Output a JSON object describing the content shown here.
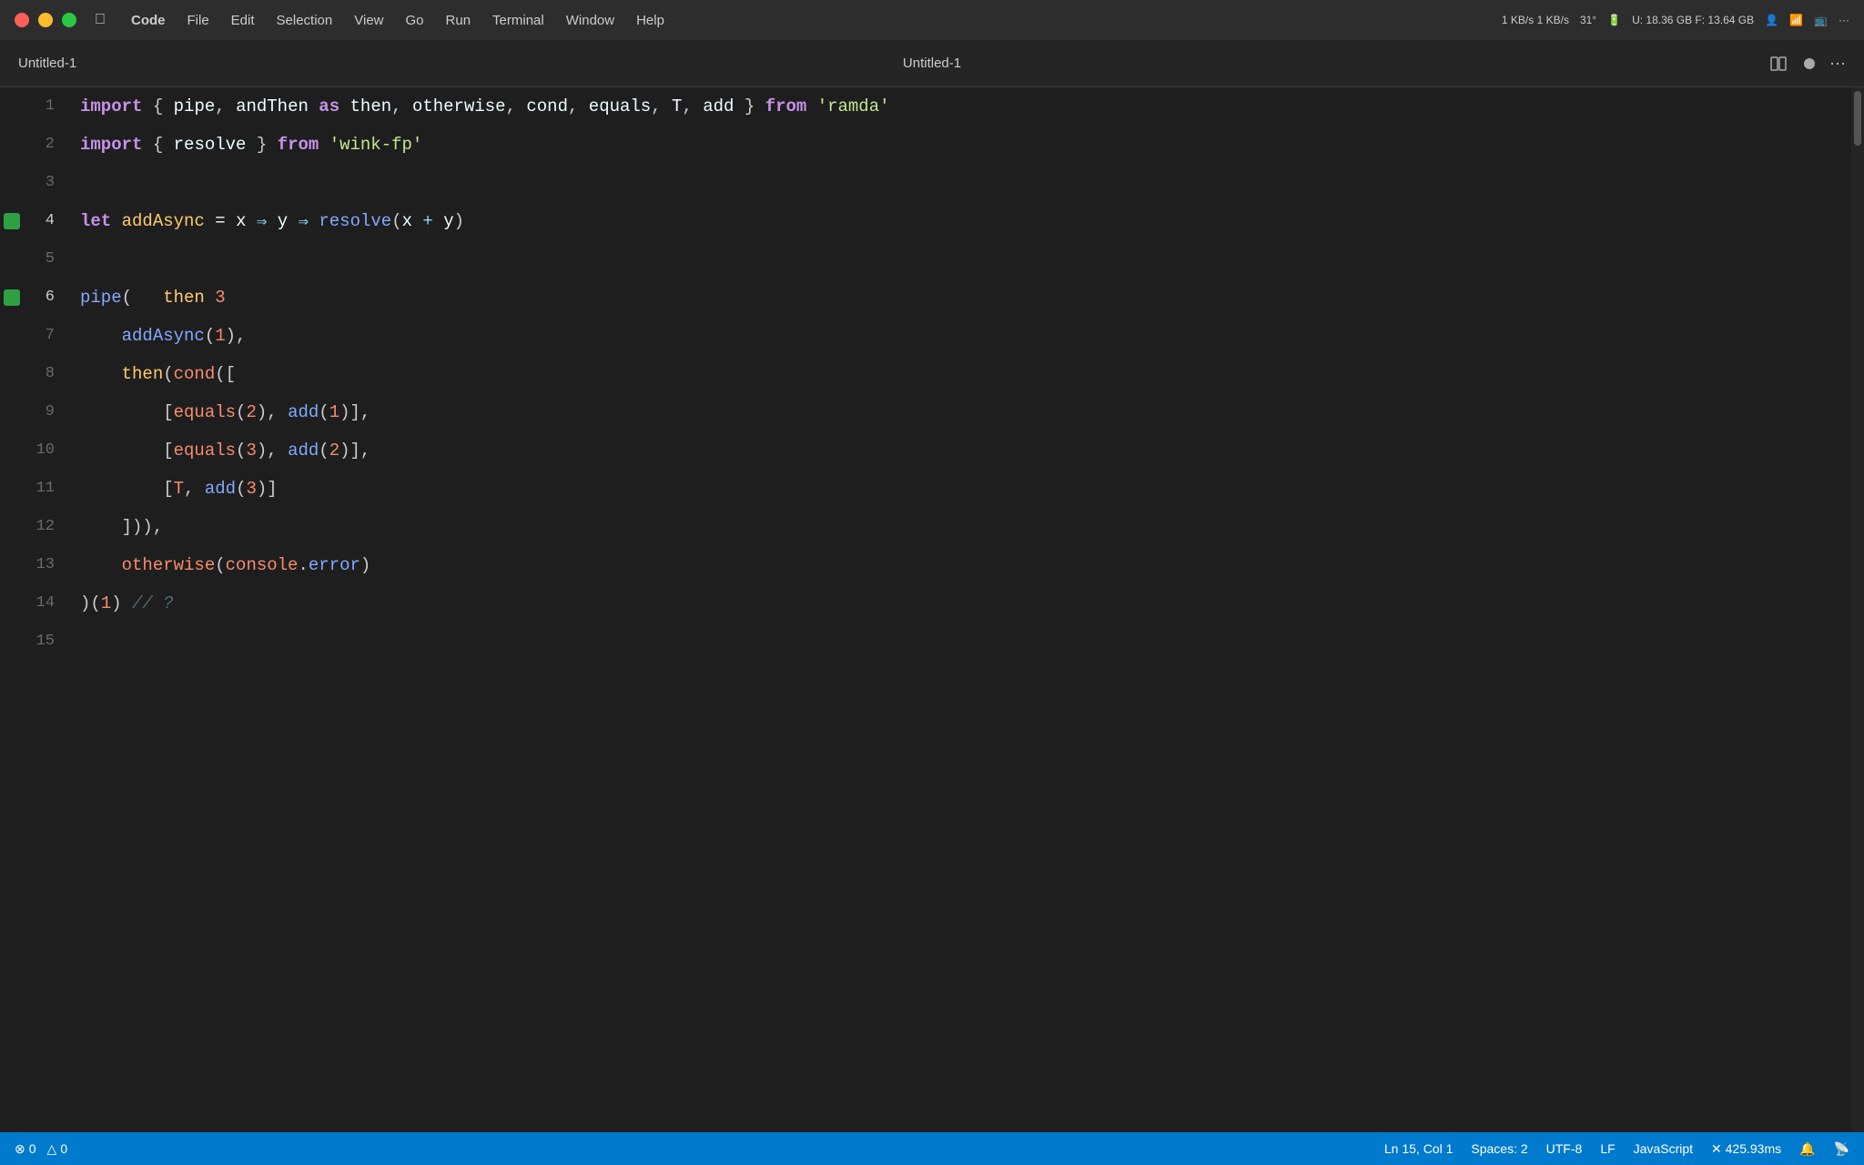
{
  "menubar": {
    "apple": "🍎",
    "items": [
      {
        "label": "Code",
        "bold": true
      },
      {
        "label": "File"
      },
      {
        "label": "Edit"
      },
      {
        "label": "Selection"
      },
      {
        "label": "View"
      },
      {
        "label": "Go"
      },
      {
        "label": "Run"
      },
      {
        "label": "Terminal"
      },
      {
        "label": "Window"
      },
      {
        "label": "Help"
      }
    ],
    "right": {
      "network": "1 KB/s\n1 KB/s",
      "temp": "31°",
      "battery": "🔋",
      "storage": "U: 18.36 GB\nF: 13.64 GB",
      "profile": "👤",
      "wifi": "📶",
      "airplay": "📺",
      "more": "···"
    }
  },
  "titlebar": {
    "title": "Untitled-1",
    "left_label": "Untitled-1"
  },
  "editor": {
    "lines": [
      {
        "num": 1,
        "breakpoint": false,
        "tokens": [
          {
            "text": "import",
            "cls": "kw-import"
          },
          {
            "text": " { ",
            "cls": "punct"
          },
          {
            "text": "pipe",
            "cls": "plain"
          },
          {
            "text": ", ",
            "cls": "punct"
          },
          {
            "text": "andThen",
            "cls": "plain"
          },
          {
            "text": " ",
            "cls": "plain"
          },
          {
            "text": "as",
            "cls": "kw-as"
          },
          {
            "text": " ",
            "cls": "plain"
          },
          {
            "text": "then",
            "cls": "plain"
          },
          {
            "text": ", ",
            "cls": "punct"
          },
          {
            "text": "otherwise",
            "cls": "plain"
          },
          {
            "text": ", ",
            "cls": "punct"
          },
          {
            "text": "cond",
            "cls": "plain"
          },
          {
            "text": ", ",
            "cls": "punct"
          },
          {
            "text": "equals",
            "cls": "plain"
          },
          {
            "text": ", ",
            "cls": "punct"
          },
          {
            "text": "T",
            "cls": "plain"
          },
          {
            "text": ", ",
            "cls": "punct"
          },
          {
            "text": "add",
            "cls": "plain"
          },
          {
            "text": " } ",
            "cls": "punct"
          },
          {
            "text": "from",
            "cls": "kw-from"
          },
          {
            "text": " ",
            "cls": "plain"
          },
          {
            "text": "'ramda'",
            "cls": "str"
          }
        ]
      },
      {
        "num": 2,
        "breakpoint": false,
        "tokens": [
          {
            "text": "import",
            "cls": "kw-import"
          },
          {
            "text": " { ",
            "cls": "punct"
          },
          {
            "text": "resolve",
            "cls": "plain"
          },
          {
            "text": " } ",
            "cls": "punct"
          },
          {
            "text": "from",
            "cls": "kw-from"
          },
          {
            "text": " ",
            "cls": "plain"
          },
          {
            "text": "'wink-fp'",
            "cls": "str"
          }
        ]
      },
      {
        "num": 3,
        "breakpoint": false,
        "tokens": []
      },
      {
        "num": 4,
        "breakpoint": true,
        "tokens": [
          {
            "text": "let",
            "cls": "kw-let"
          },
          {
            "text": " ",
            "cls": "plain"
          },
          {
            "text": "addAsync",
            "cls": "addAsync-var"
          },
          {
            "text": " = ",
            "cls": "plain"
          },
          {
            "text": "x",
            "cls": "plain"
          },
          {
            "text": " ⇒ ",
            "cls": "arrow"
          },
          {
            "text": "y",
            "cls": "plain"
          },
          {
            "text": " ⇒ ",
            "cls": "arrow"
          },
          {
            "text": "resolve",
            "cls": "kw-resolve"
          },
          {
            "text": "(",
            "cls": "punct"
          },
          {
            "text": "x",
            "cls": "plain"
          },
          {
            "text": " + ",
            "cls": "op"
          },
          {
            "text": "y",
            "cls": "plain"
          },
          {
            "text": ")",
            "cls": "punct"
          }
        ]
      },
      {
        "num": 5,
        "breakpoint": false,
        "tokens": []
      },
      {
        "num": 6,
        "breakpoint": true,
        "tokens": [
          {
            "text": "pipe",
            "cls": "kw-pipe"
          },
          {
            "text": "(   ",
            "cls": "punct"
          },
          {
            "text": "then",
            "cls": "kw-then"
          },
          {
            "text": " ",
            "cls": "plain"
          },
          {
            "text": "3",
            "cls": "num"
          }
        ]
      },
      {
        "num": 7,
        "breakpoint": false,
        "indent": 1,
        "tokens": [
          {
            "text": "    addAsync",
            "cls": "fn-name"
          },
          {
            "text": "(",
            "cls": "punct"
          },
          {
            "text": "1",
            "cls": "num"
          },
          {
            "text": "),",
            "cls": "punct"
          }
        ]
      },
      {
        "num": 8,
        "breakpoint": false,
        "indent": 1,
        "tokens": [
          {
            "text": "    then",
            "cls": "kw-then"
          },
          {
            "text": "(",
            "cls": "punct"
          },
          {
            "text": "cond",
            "cls": "kw-cond"
          },
          {
            "text": "([",
            "cls": "punct"
          }
        ]
      },
      {
        "num": 9,
        "breakpoint": false,
        "indent": 2,
        "tokens": [
          {
            "text": "        [",
            "cls": "punct"
          },
          {
            "text": "equals",
            "cls": "kw-equals"
          },
          {
            "text": "(",
            "cls": "punct"
          },
          {
            "text": "2",
            "cls": "num"
          },
          {
            "text": "), ",
            "cls": "punct"
          },
          {
            "text": "add",
            "cls": "kw-add"
          },
          {
            "text": "(",
            "cls": "punct"
          },
          {
            "text": "1",
            "cls": "num"
          },
          {
            "text": ")],",
            "cls": "punct"
          }
        ]
      },
      {
        "num": 10,
        "breakpoint": false,
        "indent": 2,
        "tokens": [
          {
            "text": "        [",
            "cls": "punct"
          },
          {
            "text": "equals",
            "cls": "kw-equals"
          },
          {
            "text": "(",
            "cls": "punct"
          },
          {
            "text": "3",
            "cls": "num"
          },
          {
            "text": "), ",
            "cls": "punct"
          },
          {
            "text": "add",
            "cls": "kw-add"
          },
          {
            "text": "(",
            "cls": "punct"
          },
          {
            "text": "2",
            "cls": "num"
          },
          {
            "text": ")],",
            "cls": "punct"
          }
        ]
      },
      {
        "num": 11,
        "breakpoint": false,
        "indent": 2,
        "tokens": [
          {
            "text": "        [",
            "cls": "punct"
          },
          {
            "text": "T",
            "cls": "kw-T"
          },
          {
            "text": ", ",
            "cls": "punct"
          },
          {
            "text": "add",
            "cls": "kw-add"
          },
          {
            "text": "(",
            "cls": "punct"
          },
          {
            "text": "3",
            "cls": "num"
          },
          {
            "text": ")]",
            "cls": "punct"
          }
        ]
      },
      {
        "num": 12,
        "breakpoint": false,
        "indent": 1,
        "tokens": [
          {
            "text": "    ])),",
            "cls": "punct"
          }
        ]
      },
      {
        "num": 13,
        "breakpoint": false,
        "indent": 1,
        "tokens": [
          {
            "text": "    otherwise",
            "cls": "kw-otherwise"
          },
          {
            "text": "(",
            "cls": "punct"
          },
          {
            "text": "console",
            "cls": "kw-console"
          },
          {
            "text": ".",
            "cls": "punct"
          },
          {
            "text": "error",
            "cls": "kw-error"
          },
          {
            "text": ")",
            "cls": "punct"
          }
        ]
      },
      {
        "num": 14,
        "breakpoint": false,
        "tokens": [
          {
            "text": ")(",
            "cls": "punct"
          },
          {
            "text": "1",
            "cls": "num"
          },
          {
            "text": ") ",
            "cls": "punct"
          },
          {
            "text": "// ?",
            "cls": "comment"
          }
        ]
      },
      {
        "num": 15,
        "breakpoint": false,
        "tokens": []
      }
    ]
  },
  "statusbar": {
    "errors": "0",
    "warnings": "0",
    "position": "Ln 15, Col 1",
    "spaces": "Spaces: 2",
    "encoding": "UTF-8",
    "eol": "LF",
    "language": "JavaScript",
    "timing": "✕ 425.93ms",
    "bell_icon": "🔔",
    "broadcast_icon": "📡"
  }
}
